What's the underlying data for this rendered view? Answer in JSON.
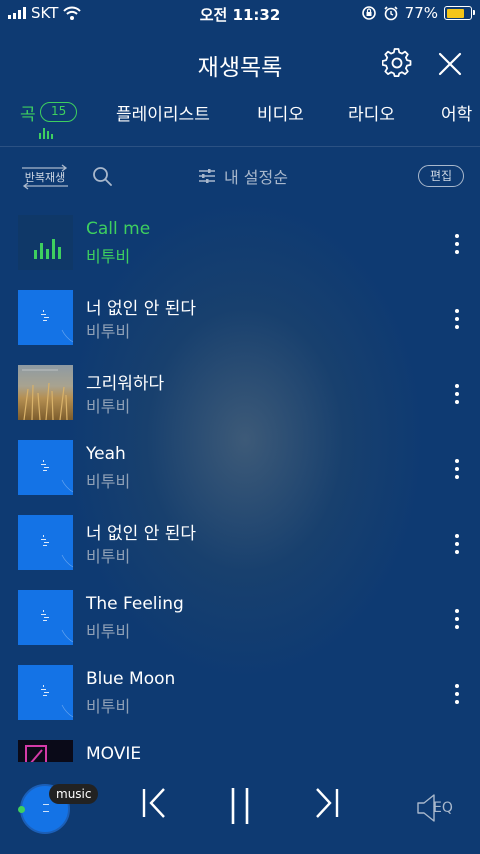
{
  "status": {
    "carrier": "SKT",
    "time": "오전 11:32",
    "battery": "77%",
    "battery_level": 0.77
  },
  "header": {
    "title": "재생목록"
  },
  "tabs": [
    {
      "label": "곡",
      "active": true,
      "badge": "15"
    },
    {
      "label": "플레이리스트"
    },
    {
      "label": "비디오"
    },
    {
      "label": "라디오"
    },
    {
      "label": "어학"
    }
  ],
  "toolbar": {
    "repeat_label": "반복재생",
    "sort_label": "내 설정순",
    "edit_label": "편집"
  },
  "songs": [
    {
      "title": "Call me",
      "artist": "비투비",
      "playing": true
    },
    {
      "title": "너 없인 안 된다",
      "artist": "비투비"
    },
    {
      "title": "그리워하다",
      "artist": "비투비"
    },
    {
      "title": "Yeah",
      "artist": "비투비"
    },
    {
      "title": "너 없인 안 된다",
      "artist": "비투비"
    },
    {
      "title": "The Feeling",
      "artist": "비투비"
    },
    {
      "title": "Blue Moon",
      "artist": "비투비"
    },
    {
      "title": "MOVIE",
      "artist": ""
    }
  ],
  "player": {
    "tag": "music",
    "eq_label": "EQ"
  },
  "colors": {
    "background": "#0e3a72",
    "accent": "#3ecf5f",
    "album_blue": "#1473e6"
  }
}
